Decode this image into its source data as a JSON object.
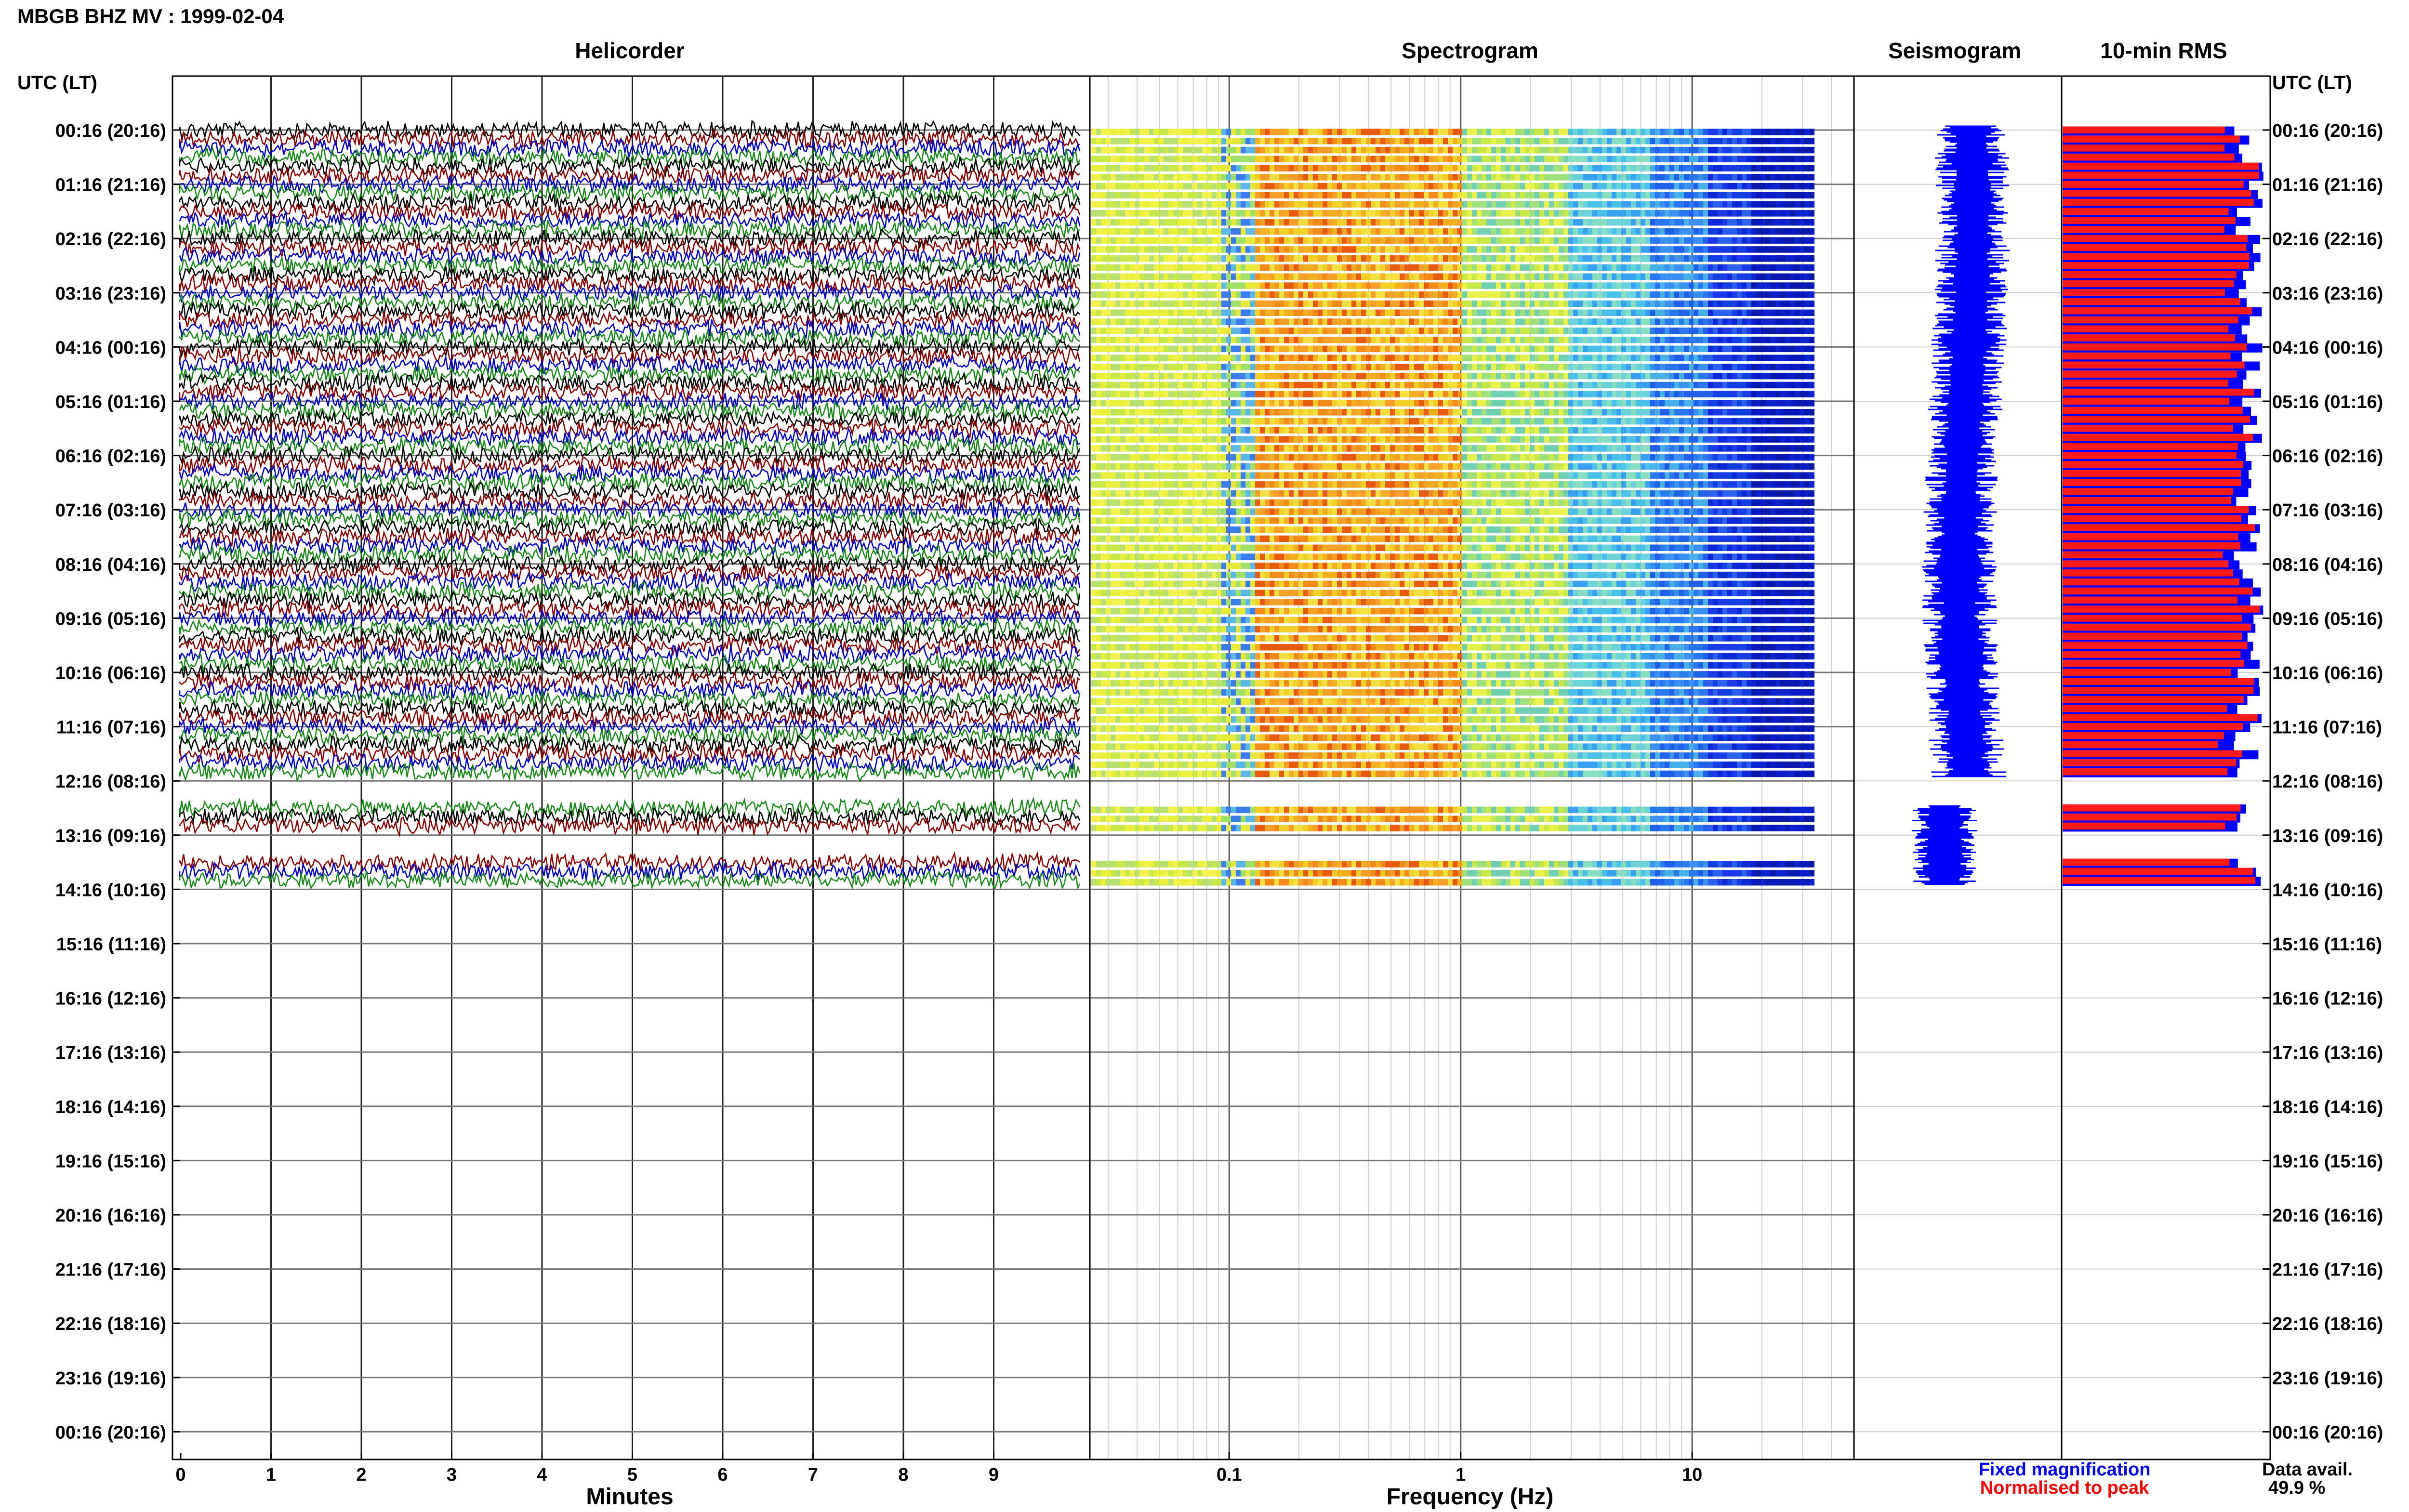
{
  "header": {
    "title": "MBGB BHZ MV : 1999-02-04"
  },
  "panels": {
    "helicorder": "Helicorder",
    "spectrogram": "Spectrogram",
    "seismogram": "Seismogram",
    "rms": "10-min RMS"
  },
  "axis_headers": {
    "left": "UTC (LT)",
    "right": "UTC (LT)"
  },
  "x_labels": {
    "helicorder": "Minutes",
    "spectrogram": "Frequency (Hz)"
  },
  "legend": {
    "fixed": "Fixed magnification",
    "normalised": "Normalised to peak",
    "fixed_color": "#0000ff",
    "normalised_color": "#ff0000"
  },
  "availability": {
    "label": "Data avail.",
    "value": "49.9 %"
  },
  "chart_data": {
    "type": "helicorder",
    "row_labels": [
      "00:16 (20:16)",
      "01:16 (21:16)",
      "02:16 (22:16)",
      "03:16 (23:16)",
      "04:16 (00:16)",
      "05:16 (01:16)",
      "06:16 (02:16)",
      "07:16 (03:16)",
      "08:16 (04:16)",
      "09:16 (05:16)",
      "10:16 (06:16)",
      "11:16 (07:16)",
      "12:16 (08:16)",
      "13:16 (09:16)",
      "14:16 (10:16)",
      "15:16 (11:16)",
      "16:16 (12:16)",
      "17:16 (13:16)",
      "18:16 (14:16)",
      "19:16 (15:16)",
      "20:16 (16:16)",
      "21:16 (17:16)",
      "22:16 (18:16)",
      "23:16 (19:16)",
      "00:16 (20:16)"
    ],
    "minutes_ticks": [
      0,
      1,
      2,
      3,
      4,
      5,
      6,
      7,
      8,
      9
    ],
    "freq_ticks": [
      {
        "value": 0.1,
        "label": "0.1"
      },
      {
        "value": 1,
        "label": "1"
      },
      {
        "value": 10,
        "label": "10"
      }
    ],
    "freq_range": [
      0.025,
      50
    ],
    "trace_colors": [
      "#000000",
      "#8b0000",
      "#0000cd",
      "#1a8a1a"
    ],
    "data_hours": 12,
    "gap_rows": [
      12
    ],
    "data_rows_after_gap": 1,
    "traces_per_hour": 6,
    "availability_percent": 49.9
  }
}
